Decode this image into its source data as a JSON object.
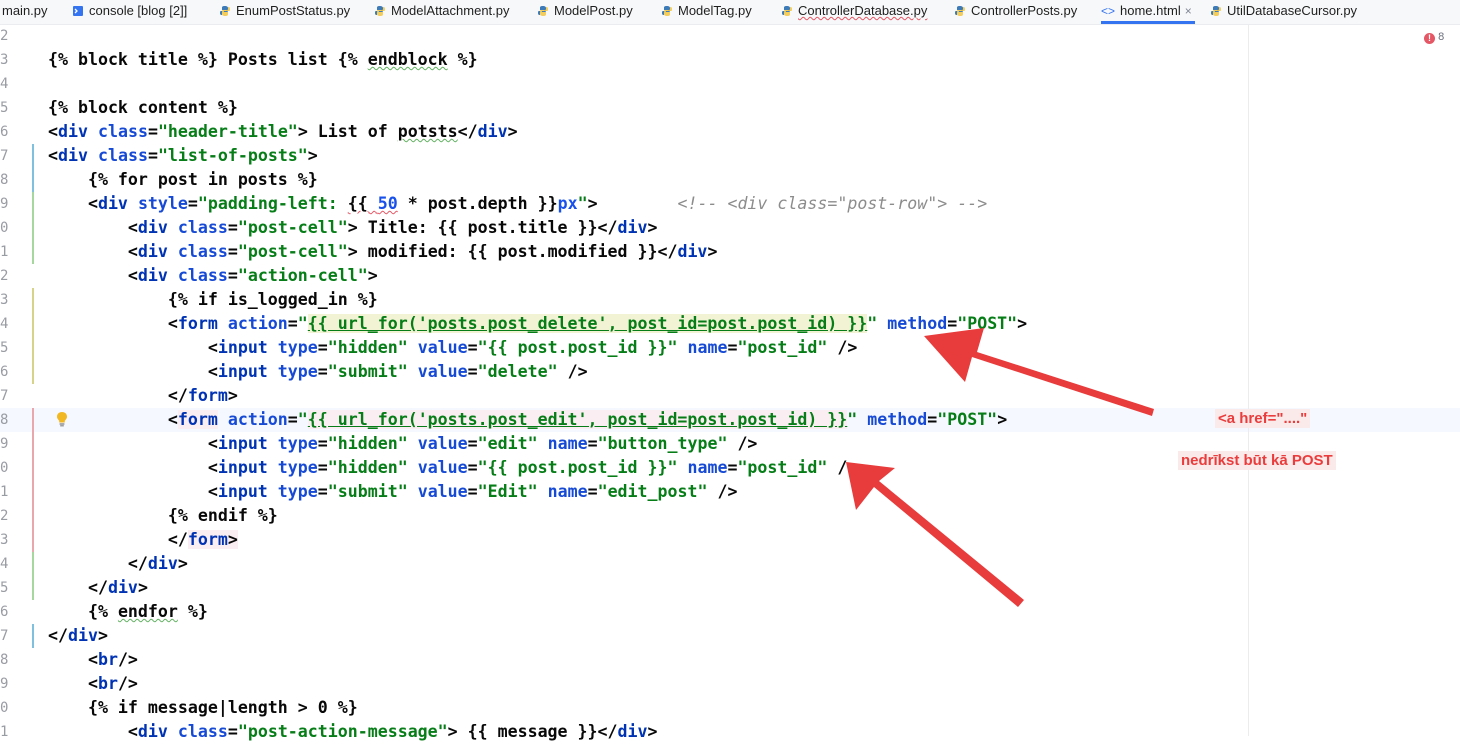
{
  "tabs": [
    {
      "label": "main.py",
      "icon": "python-file-icon"
    },
    {
      "label": "console [blog [2]]",
      "icon": "console-icon"
    },
    {
      "label": "EnumPostStatus.py",
      "icon": "python-file-icon"
    },
    {
      "label": "ModelAttachment.py",
      "icon": "python-file-icon"
    },
    {
      "label": "ModelPost.py",
      "icon": "python-file-icon"
    },
    {
      "label": "ModelTag.py",
      "icon": "python-file-icon"
    },
    {
      "label": "ControllerDatabase.py",
      "icon": "python-file-icon",
      "has_error": true
    },
    {
      "label": "ControllerPosts.py",
      "icon": "python-file-icon"
    },
    {
      "label": "home.html",
      "icon": "html-file-icon",
      "active": true,
      "close": "×"
    },
    {
      "label": "UtilDatabaseCursor.py",
      "icon": "python-file-icon"
    }
  ],
  "inspection": {
    "count": "8",
    "icon": "error-icon",
    "color": "#e55765"
  },
  "line_numbers": [
    "2",
    "3",
    "4",
    "5",
    "6",
    "7",
    "8",
    "9",
    "0",
    "1",
    "2",
    "3",
    "4",
    "5",
    "6",
    "7",
    "8",
    "9",
    "0",
    "1",
    "2",
    "3",
    "4",
    "5",
    "6",
    "7",
    "8",
    "9",
    "0",
    "1"
  ],
  "code": {
    "l2": "",
    "l3": [
      "{% block title %}",
      " Posts list ",
      "{% ",
      "endblock",
      " %}"
    ],
    "l4": "",
    "l5": "{% block content %}",
    "l6": [
      "<",
      "div",
      " ",
      "class",
      "=",
      "\"header-title\"",
      "> List of ",
      "potsts",
      "</",
      "div",
      ">"
    ],
    "l7": [
      "<",
      "div",
      " ",
      "class",
      "=",
      "\"list-of-posts\"",
      ">"
    ],
    "l8": "    {% for post in posts %}",
    "l9": [
      "    <",
      "div",
      " ",
      "style",
      "=",
      "\"padding-left: ",
      "{{ ",
      "50",
      " * post.depth }}",
      "px",
      "\"",
      ">",
      "        ",
      "<!-- <div class=\"post-row\"> -->"
    ],
    "l10": [
      "        <",
      "div",
      " ",
      "class",
      "=",
      "\"post-cell\"",
      "> Title: {{ post.title }}</",
      "div",
      ">"
    ],
    "l11": [
      "        <",
      "div",
      " ",
      "class",
      "=",
      "\"post-cell\"",
      "> modified: {{ post.modified }}</",
      "div",
      ">"
    ],
    "l12": [
      "        <",
      "div",
      " ",
      "class",
      "=",
      "\"action-cell\"",
      ">"
    ],
    "l13": "            {% if is_logged_in %}",
    "l14": [
      "            <",
      "form",
      " ",
      "action",
      "=",
      "\"",
      "{{ url_for('posts.post_delete', post_id=post.post_id) }}",
      "\"",
      " ",
      "method",
      "=",
      "\"POST\"",
      ">"
    ],
    "l15": [
      "                <",
      "input",
      " ",
      "type",
      "=",
      "\"hidden\"",
      " ",
      "value",
      "=",
      "\"{{ post.post_id }}\"",
      " ",
      "name",
      "=",
      "\"post_id\"",
      " />"
    ],
    "l16": [
      "                <",
      "input",
      " ",
      "type",
      "=",
      "\"submit\"",
      " ",
      "value",
      "=",
      "\"delete\"",
      " />"
    ],
    "l17": [
      "            </",
      "form",
      ">"
    ],
    "l18": [
      "            <",
      "form",
      " ",
      "action",
      "=",
      "\"",
      "{{ url_for('posts.post_edit', post_id=post.post_id) }}",
      "\"",
      " ",
      "method",
      "=",
      "\"POST\"",
      ">"
    ],
    "l19": [
      "                <",
      "input",
      " ",
      "type",
      "=",
      "\"hidden\"",
      " ",
      "value",
      "=",
      "\"edit\"",
      " ",
      "name",
      "=",
      "\"button_type\"",
      " />"
    ],
    "l20": [
      "                <",
      "input",
      " ",
      "type",
      "=",
      "\"hidden\"",
      " ",
      "value",
      "=",
      "\"{{ post.post_id }}\"",
      " ",
      "name",
      "=",
      "\"post_id\"",
      " />"
    ],
    "l21": [
      "                <",
      "input",
      " ",
      "type",
      "=",
      "\"submit\"",
      " ",
      "value",
      "=",
      "\"Edit\"",
      " ",
      "name",
      "=",
      "\"edit_post\"",
      " />"
    ],
    "l22": "            {% endif %}",
    "l23": [
      "            </",
      "form",
      ">"
    ],
    "l24": [
      "        </",
      "div",
      ">"
    ],
    "l25": [
      "    </",
      "div",
      ">"
    ],
    "l26": [
      "    {% ",
      "endfor",
      " %}"
    ],
    "l27": [
      "</",
      "div",
      ">"
    ],
    "l28": [
      "    <",
      "br",
      "/>"
    ],
    "l29": [
      "    <",
      "br",
      "/>"
    ],
    "l30": "    {% if message|length > 0 %}",
    "l31": [
      "        <",
      "div",
      " ",
      "class",
      "=",
      "\"post-action-message\"",
      "> {{ message }}</",
      "div",
      ">"
    ]
  },
  "annotations": {
    "note1": "<a href=\"....\"",
    "note2": "nedrīkst būt kā  POST",
    "arrow_color": "#e83b3b"
  }
}
